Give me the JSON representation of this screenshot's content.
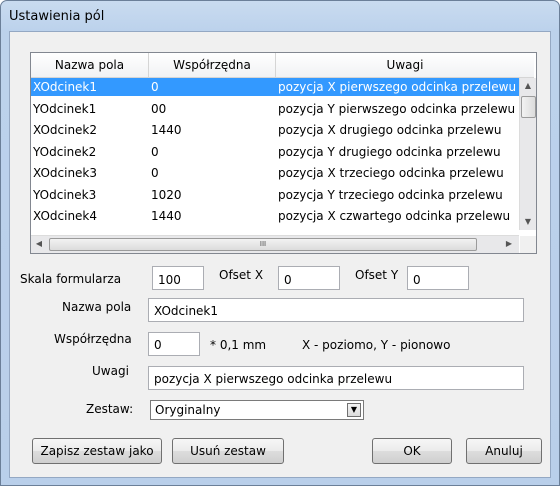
{
  "window": {
    "title": "Ustawienia pól"
  },
  "table": {
    "columns": [
      "Nazwa pola",
      "Współrzędna",
      "Uwagi"
    ],
    "rows": [
      [
        "XOdcinek1",
        "0",
        "pozycja X pierwszego odcinka przelewu"
      ],
      [
        "YOdcinek1",
        "00",
        "pozycja Y pierwszego odcinka przelewu"
      ],
      [
        "XOdcinek2",
        "1440",
        "pozycja X drugiego odcinka przelewu"
      ],
      [
        "YOdcinek2",
        "0",
        "pozycja Y drugiego odcinka przelewu"
      ],
      [
        "XOdcinek3",
        "0",
        "pozycja X trzeciego odcinka przelewu"
      ],
      [
        "YOdcinek3",
        "1020",
        "pozycja Y trzeciego odcinka przelewu"
      ],
      [
        "XOdcinek4",
        "1440",
        "pozycja X czwartego odcinka przelewu"
      ]
    ],
    "selected_row": 0,
    "hscroll_grip": "III"
  },
  "form": {
    "skala_label": "Skala formularza",
    "skala_value": "100",
    "ofset_x_label": "Ofset X",
    "ofset_x_value": "0",
    "ofset_y_label": "Ofset Y",
    "ofset_y_value": "0",
    "nazwa_label": "Nazwa pola",
    "nazwa_value": "XOdcinek1",
    "wsp_label": "Współrzędna",
    "wsp_value": "0",
    "wsp_unit": "* 0,1 mm",
    "wsp_hint": "X - poziomo, Y - pionowo",
    "uwagi_label": "Uwagi",
    "uwagi_value": "pozycja X pierwszego odcinka przelewu",
    "zestaw_label": "Zestaw:",
    "zestaw_value": "Oryginalny"
  },
  "buttons": {
    "save_set": "Zapisz zestaw jako",
    "delete_set": "Usuń zestaw",
    "ok": "OK",
    "cancel": "Anuluj"
  }
}
